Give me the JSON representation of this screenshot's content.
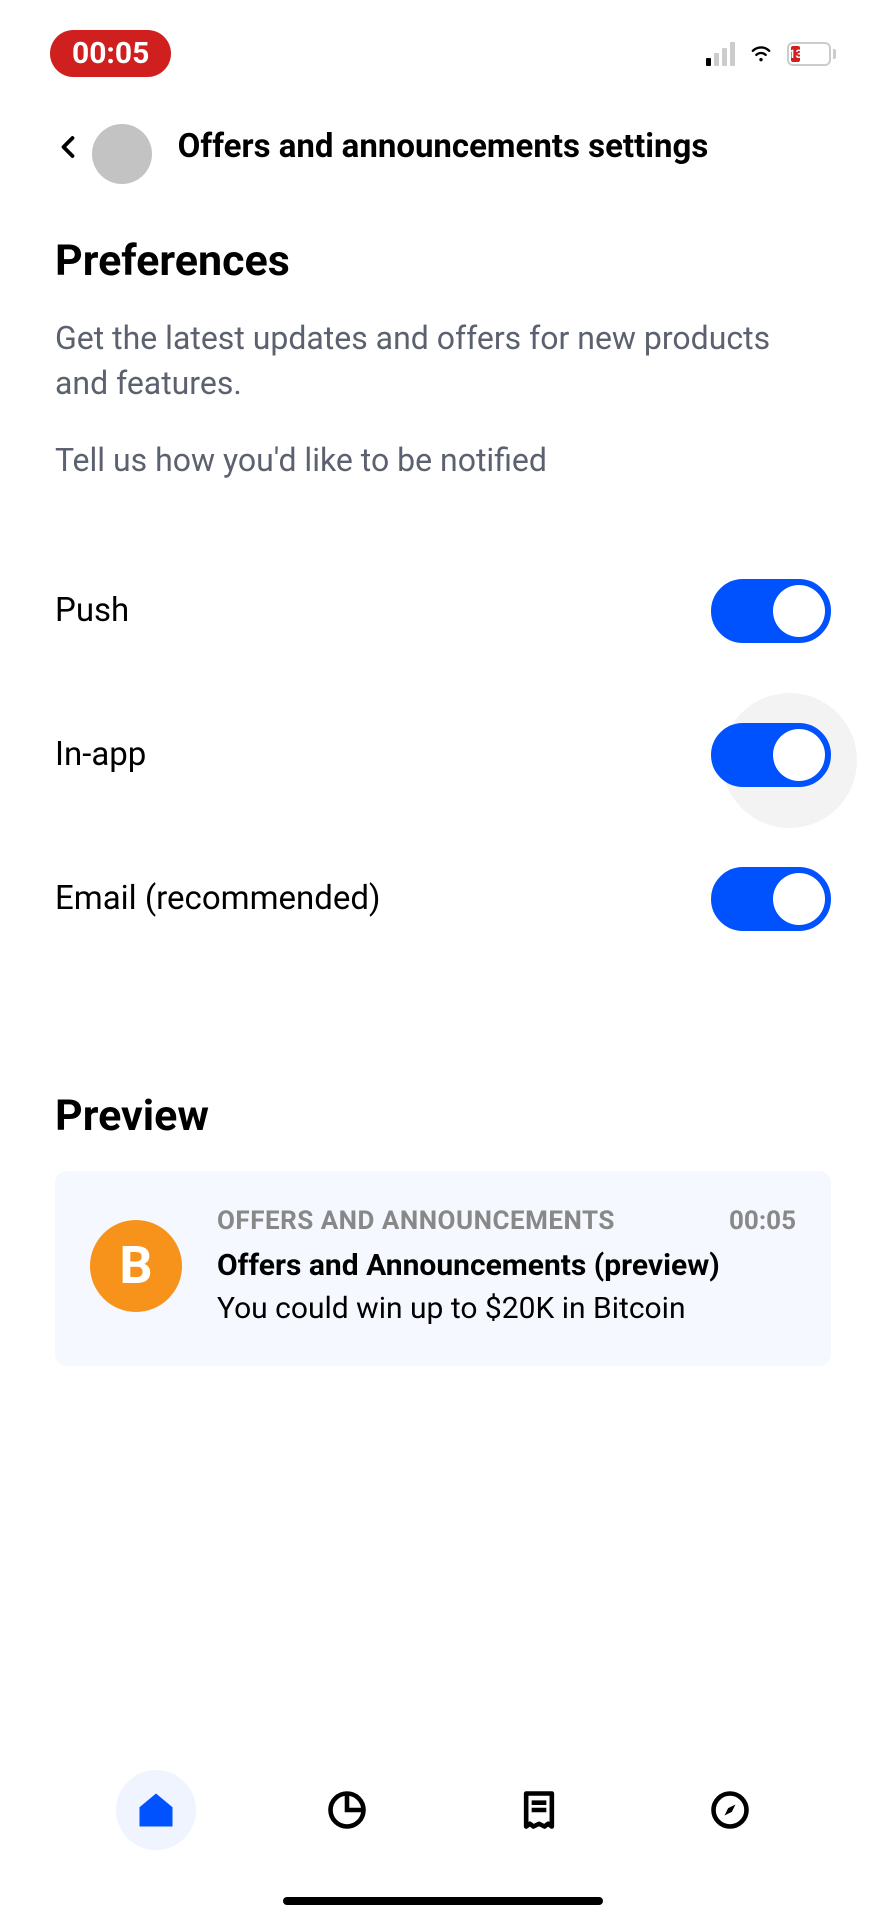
{
  "statusBar": {
    "time": "00:05",
    "batteryLevel": "13"
  },
  "header": {
    "title": "Offers and announcements settings"
  },
  "preferences": {
    "title": "Preferences",
    "description": "Get the latest updates and offers for new products and features.",
    "subtext": "Tell us how you'd like to be notified",
    "toggles": [
      {
        "label": "Push",
        "enabled": true
      },
      {
        "label": "In-app",
        "enabled": true
      },
      {
        "label": "Email (recommended)",
        "enabled": true
      }
    ]
  },
  "preview": {
    "title": "Preview",
    "card": {
      "category": "OFFERS AND ANNOUNCEMENTS",
      "time": "00:05",
      "heading": "Offers and Announcements (preview)",
      "body": "You could win up to $20K in Bitcoin",
      "iconSymbol": "B"
    }
  }
}
